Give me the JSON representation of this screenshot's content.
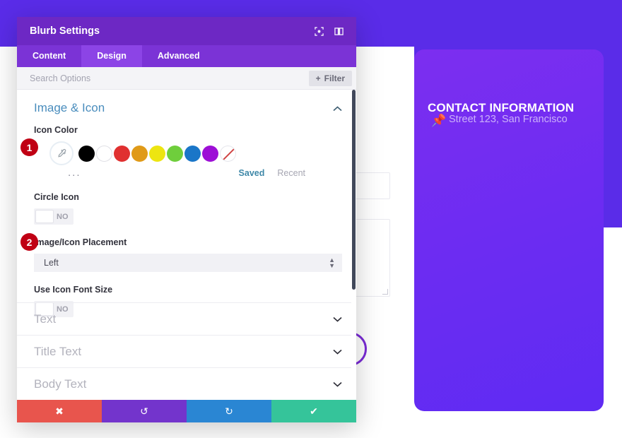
{
  "background": {
    "card": {
      "title": "CONTACT INFORMATION",
      "subtitle": "Street 123, San Francisco",
      "pin_icon": "map-pin-icon",
      "color": "#7c2ef0"
    },
    "band_color": "#5a2ce8"
  },
  "modal": {
    "title": "Blurb Settings",
    "header_icons": [
      {
        "name": "expand-fullscreen-icon",
        "glyph": "⛶"
      },
      {
        "name": "panel-layout-icon",
        "glyph": "▣"
      }
    ],
    "tabs": [
      {
        "label": "Content",
        "active": false
      },
      {
        "label": "Design",
        "active": true
      },
      {
        "label": "Advanced",
        "active": false
      }
    ],
    "search": {
      "placeholder": "Search Options",
      "filter_label": "Filter",
      "filter_icon": "plus-icon"
    },
    "sections": {
      "image_icon": {
        "title": "Image & Icon",
        "expanded": true,
        "chevron": "chevron-up-icon",
        "icon_color": {
          "label": "Icon Color",
          "eyedropper_icon": "eyedropper-icon",
          "swatches": [
            "#000000",
            "#ffffff",
            "#e03030",
            "#e09a18",
            "#ede511",
            "#6fce3c",
            "#1a76c8",
            "#9d0fd6",
            "none"
          ],
          "more_options": "...",
          "saved_label": "Saved",
          "recent_label": "Recent"
        },
        "circle_icon": {
          "label": "Circle Icon",
          "value": "NO"
        },
        "placement": {
          "label": "Image/Icon Placement",
          "value": "Left"
        },
        "use_icon_font_size": {
          "label": "Use Icon Font Size",
          "value": "NO"
        }
      },
      "collapsed": [
        {
          "label": "Text",
          "chevron": "chevron-down-icon"
        },
        {
          "label": "Title Text",
          "chevron": "chevron-down-icon"
        },
        {
          "label": "Body Text",
          "chevron": "chevron-down-icon"
        }
      ]
    },
    "actions": [
      {
        "name": "cancel-button",
        "icon": "close-icon",
        "glyph": "✖",
        "color": "#e8554d"
      },
      {
        "name": "undo-button",
        "icon": "undo-icon",
        "glyph": "↺",
        "color": "#7334cc"
      },
      {
        "name": "redo-button",
        "icon": "redo-icon",
        "glyph": "↻",
        "color": "#2a86d3"
      },
      {
        "name": "save-button",
        "icon": "check-icon",
        "glyph": "✔",
        "color": "#35c49a"
      }
    ]
  },
  "callouts": [
    {
      "number": "1"
    },
    {
      "number": "2"
    }
  ]
}
